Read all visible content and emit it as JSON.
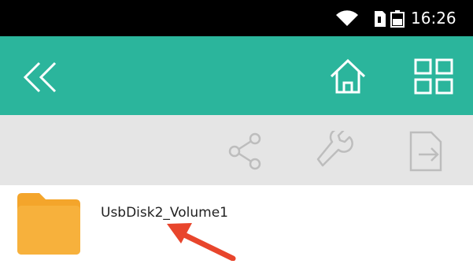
{
  "status_bar": {
    "time": "16:26",
    "icons": [
      "wifi-icon",
      "sim-card-icon",
      "battery-icon"
    ]
  },
  "toolbar": {
    "color": "#2bb59c",
    "buttons": [
      "back-icon",
      "home-icon",
      "grid-view-icon"
    ]
  },
  "action_bar": {
    "color": "#e5e5e5",
    "buttons": [
      "share-icon",
      "wrench-icon",
      "export-icon"
    ]
  },
  "files": [
    {
      "name": "UsbDisk2_Volume1",
      "icon": "folder-icon"
    }
  ],
  "annotation": {
    "color": "#e8452c",
    "icon": "red-arrow"
  }
}
